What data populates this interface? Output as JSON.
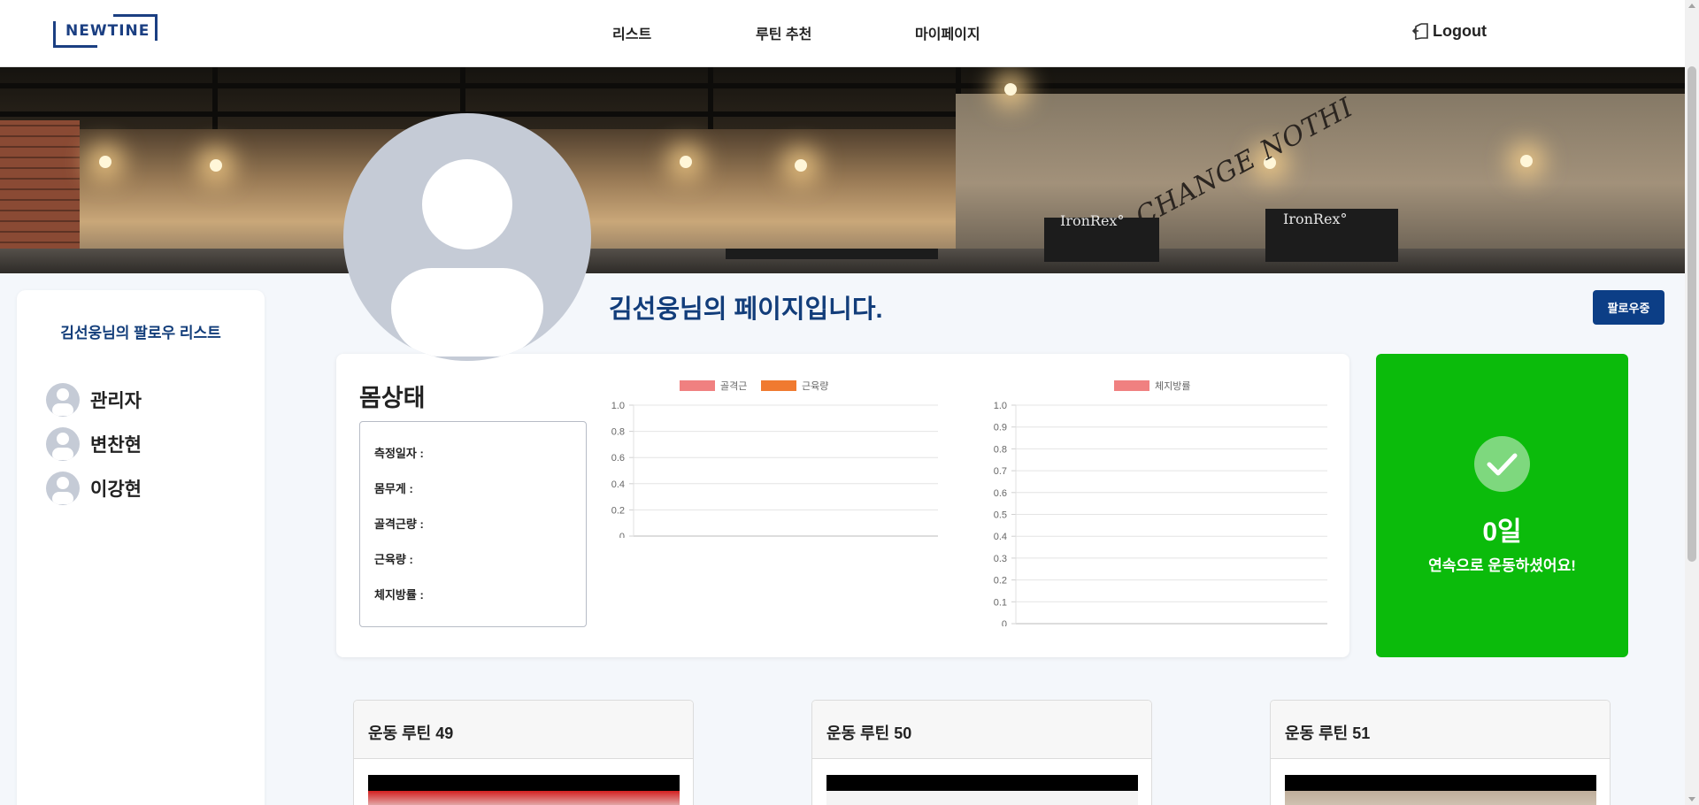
{
  "brand": {
    "logo_text": "NEWTINE",
    "primary_color": "#0c3e86",
    "accent_green": "#0bbb0b"
  },
  "nav": {
    "items": [
      {
        "label": "리스트"
      },
      {
        "label": "루틴 추천"
      },
      {
        "label": "마이페이지"
      }
    ],
    "logout_label": "Logout",
    "logout_icon": "logout-icon"
  },
  "banner": {
    "wall_text": "CHANGE NOTHI",
    "brand_tag_1": "IronRex°",
    "brand_tag_2": "IronRex°"
  },
  "sidebar": {
    "title": "김선웅님의 팔로우 리스트",
    "followers": [
      {
        "name": "관리자"
      },
      {
        "name": "변찬현"
      },
      {
        "name": "이강현"
      }
    ]
  },
  "profile": {
    "page_title": "김선웅님의 페이지입니다.",
    "follow_button": "팔로우중"
  },
  "body_status": {
    "heading": "몸상태",
    "fields": [
      {
        "label": "측정일자 :"
      },
      {
        "label": "몸무게 :"
      },
      {
        "label": "골격근량 :"
      },
      {
        "label": "근육량 :"
      },
      {
        "label": "체지방률 :"
      }
    ]
  },
  "chart_data": [
    {
      "type": "bar",
      "series": [
        {
          "name": "골격근",
          "color": "#f08080",
          "values": []
        },
        {
          "name": "근육량",
          "color": "#f07a30",
          "values": []
        }
      ],
      "categories": [],
      "ylim": [
        0,
        1.0
      ],
      "yticks": [
        "1.0",
        "0.8",
        "0.6",
        "0.4",
        "0.2",
        "0"
      ],
      "grid": true,
      "legend": "top-center"
    },
    {
      "type": "bar",
      "series": [
        {
          "name": "체지방률",
          "color": "#f08080",
          "values": []
        }
      ],
      "categories": [],
      "ylim": [
        0,
        1.0
      ],
      "yticks": [
        "1.0",
        "0.9",
        "0.8",
        "0.7",
        "0.6",
        "0.5",
        "0.4",
        "0.3",
        "0.2",
        "0.1",
        "0"
      ],
      "grid": true,
      "legend": "top-center"
    }
  ],
  "streak": {
    "days": "0일",
    "message": "연속으로 운동하셨어요!",
    "icon": "check-icon"
  },
  "routines": [
    {
      "title": "운동 루틴 49"
    },
    {
      "title": "운동 루틴 50"
    },
    {
      "title": "운동 루틴 51"
    }
  ]
}
